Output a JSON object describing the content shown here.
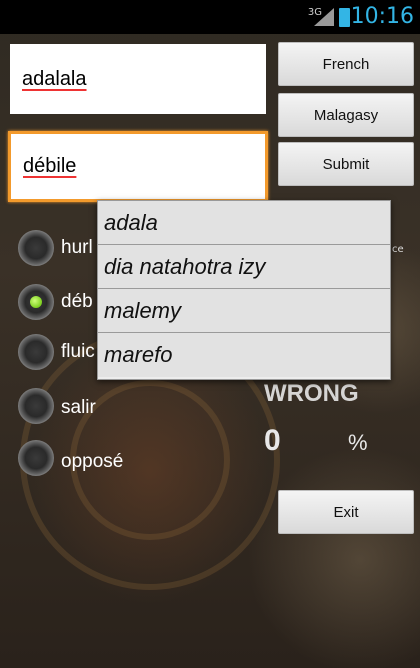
{
  "status_bar": {
    "network": "3G",
    "time": "10:16"
  },
  "inputs": {
    "source_value": "adalala",
    "target_value": "débile"
  },
  "buttons": {
    "french": "French",
    "malagasy": "Malagasy",
    "submit": "Submit",
    "exit": "Exit"
  },
  "choices": [
    {
      "label": "hurl",
      "selected": false
    },
    {
      "label": "déb",
      "selected": true
    },
    {
      "label": "fluic",
      "selected": false
    },
    {
      "label": "salir",
      "selected": false
    },
    {
      "label": "opposé",
      "selected": false
    }
  ],
  "suggestions": [
    "adala",
    "dia natahotra izy",
    "malemy",
    "marefo"
  ],
  "result": {
    "status": "WRONG",
    "score": "0",
    "percent_sign": "%",
    "hint_fragment": "ce"
  }
}
